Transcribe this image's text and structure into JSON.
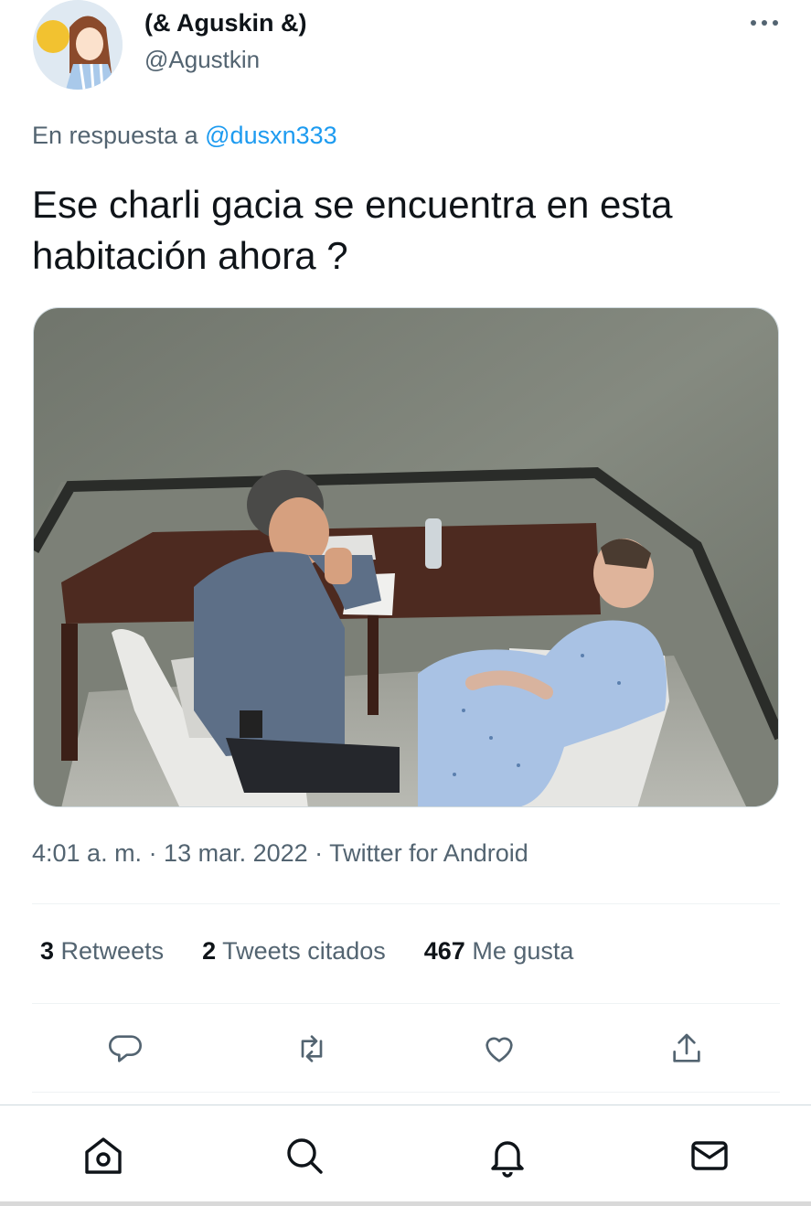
{
  "author": {
    "display_name": "(& Aguskin &)",
    "handle": "@Agustkin"
  },
  "reply": {
    "prefix": "En respuesta a",
    "to_handle": "@dusxn333"
  },
  "tweet": {
    "text": "Ese charli gacia se encuentra en esta habitación ahora ?",
    "meta": "4:01 a. m. · 13 mar. 2022 · Twitter for Android"
  },
  "stats": {
    "retweets_count": "3",
    "retweets_label": "Retweets",
    "quotes_count": "2",
    "quotes_label": "Tweets citados",
    "likes_count": "467",
    "likes_label": "Me gusta"
  },
  "actions": [
    "reply-icon",
    "retweet-icon",
    "like-icon",
    "share-icon"
  ],
  "nav": [
    "home-icon",
    "search-icon",
    "notifications-icon",
    "messages-icon"
  ],
  "colors": {
    "link": "#1d9bf0",
    "secondary_text": "#536471",
    "primary_text": "#0f1419"
  }
}
